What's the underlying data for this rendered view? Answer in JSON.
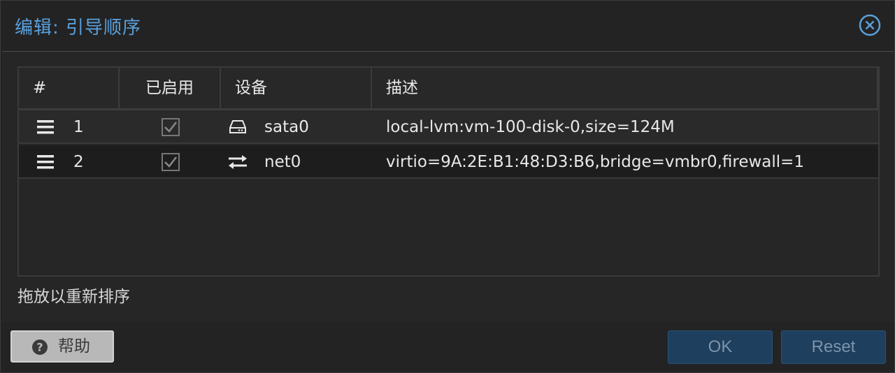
{
  "dialog": {
    "title": "编辑: 引导顺序",
    "close_icon": "close-circle-icon"
  },
  "grid": {
    "columns": [
      "#",
      "已启用",
      "设备",
      "描述"
    ],
    "rows": [
      {
        "order": "1",
        "enabled": true,
        "device_icon": "hard-disk-icon",
        "device": "sata0",
        "description": "local-lvm:vm-100-disk-0,size=124M"
      },
      {
        "order": "2",
        "enabled": true,
        "device_icon": "network-exchange-icon",
        "device": "net0",
        "description": "virtio=9A:2E:B1:48:D3:B6,bridge=vmbr0,firewall=1"
      }
    ]
  },
  "hint": "拖放以重新排序",
  "footer": {
    "help_label": "帮助",
    "ok_label": "OK",
    "reset_label": "Reset"
  },
  "colors": {
    "title": "#5aa0dc",
    "primary_button": "#1e3f5e",
    "background": "#232323"
  }
}
